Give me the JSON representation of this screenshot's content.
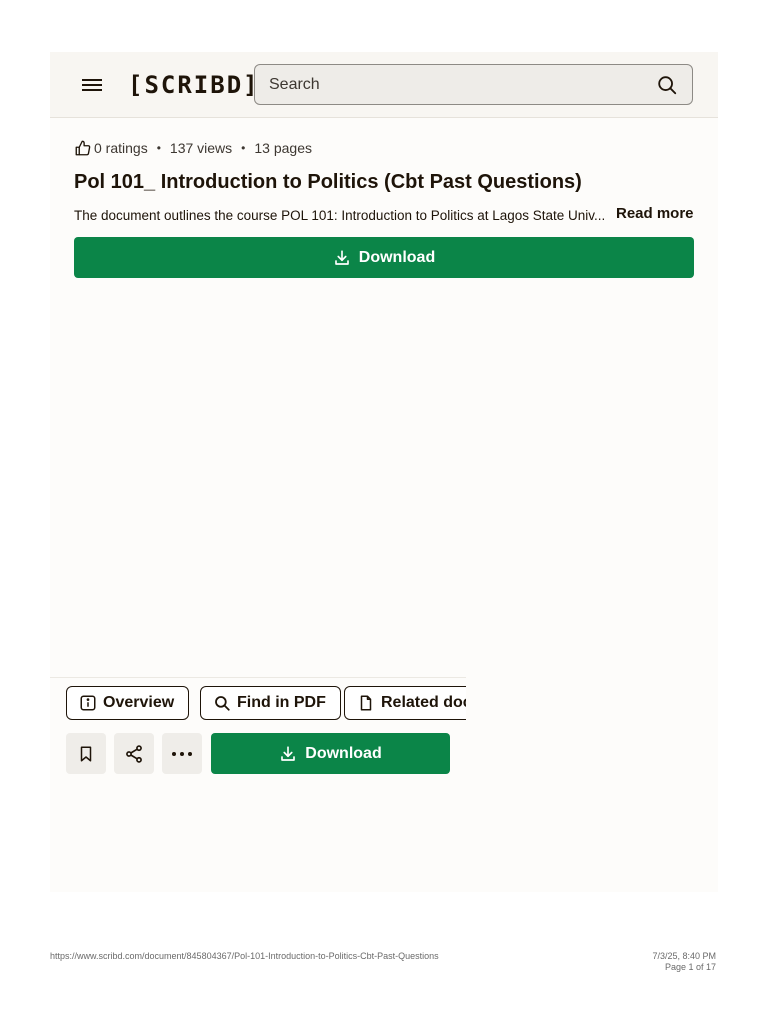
{
  "header": {
    "logo_text": "[SCRIBD]",
    "search_placeholder": "Search"
  },
  "document": {
    "ratings": "0 ratings",
    "views": "137 views",
    "pages": "13 pages",
    "separator": "•",
    "title": "Pol 101_ Introduction to Politics (Cbt Past Questions)",
    "description": "The document outlines the course POL 101: Introduction to Politics at Lagos State Univ...",
    "read_more": "Read more",
    "download_label": "Download"
  },
  "toolbar": {
    "tabs": [
      {
        "label": "Overview",
        "icon": "info-icon"
      },
      {
        "label": "Find in PDF",
        "icon": "search-icon"
      },
      {
        "label": "Related doc",
        "icon": "document-icon"
      }
    ],
    "actions": [
      {
        "icon": "bookmark-icon"
      },
      {
        "icon": "share-icon"
      },
      {
        "icon": "more-icon"
      }
    ],
    "download_label": "Download"
  },
  "footer": {
    "url": "https://www.scribd.com/document/845804367/Pol-101-Introduction-to-Politics-Cbt-Past-Questions",
    "datetime": "7/3/25, 8:40 PM",
    "page_info": "Page 1 of 17"
  },
  "colors": {
    "accent": "#0b8548",
    "text": "#1e1409",
    "header_bg": "#f8f6f2"
  }
}
